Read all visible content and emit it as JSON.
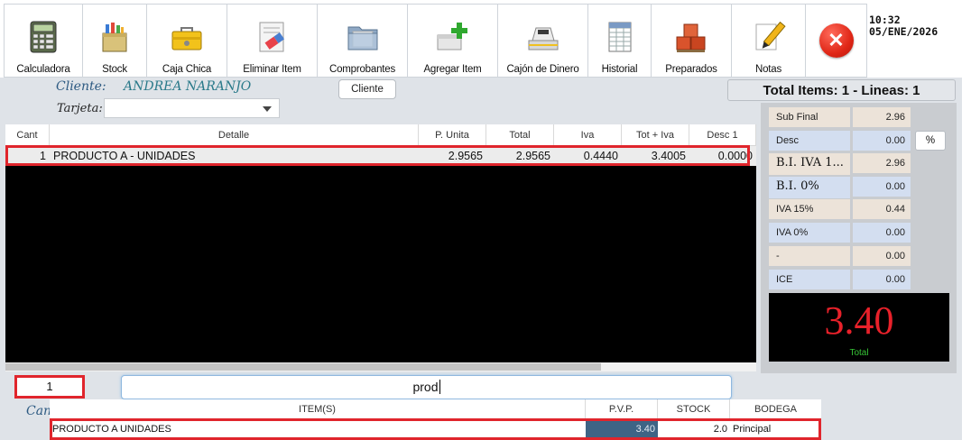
{
  "toolbar": {
    "buttons": [
      {
        "label": "Calculadora",
        "icon": "calculator-icon"
      },
      {
        "label": "Stock",
        "icon": "stock-box-icon"
      },
      {
        "label": "Caja Chica",
        "icon": "toolbox-icon"
      },
      {
        "label": "Eliminar Item",
        "icon": "eraser-icon"
      },
      {
        "label": "Comprobantes",
        "icon": "folder-icon"
      },
      {
        "label": "Agregar Item",
        "icon": "add-item-icon"
      },
      {
        "label": "Cajón de Dinero",
        "icon": "cash-register-icon"
      },
      {
        "label": "Historial",
        "icon": "spreadsheet-icon"
      },
      {
        "label": "Preparados",
        "icon": "crates-icon"
      },
      {
        "label": "Notas",
        "icon": "pencil-note-icon"
      }
    ],
    "close_icon": "close-icon"
  },
  "clock": {
    "time": "10:32",
    "date": "05/ENE/2026"
  },
  "customer": {
    "cliente_label": "Cliente:",
    "cliente_value": "ANDREA NARANJO",
    "tarjeta_label": "Tarjeta:",
    "tarjeta_value": "",
    "cliente_button": "Cliente"
  },
  "summary": {
    "total_items_text": "Total Items: 1 - Lineas: 1"
  },
  "grid": {
    "columns": [
      "Cant",
      "Detalle",
      "P. Unita",
      "Total",
      "Iva",
      "Tot + Iva",
      "Desc 1"
    ],
    "rows": [
      {
        "cant": "1",
        "detalle": "PRODUCTO A  - UNIDADES",
        "p_unita": "2.9565",
        "total": "2.9565",
        "iva": "0.4440",
        "tot_iva": "3.4005",
        "desc1": "0.0000"
      }
    ]
  },
  "totals": {
    "rows": [
      {
        "label": "Sub Final",
        "value": "2.96",
        "label_bg": "tan",
        "value_bg": "tan"
      },
      {
        "label": "Desc",
        "value": "0.00",
        "label_bg": "blue",
        "value_bg": "blue"
      },
      {
        "label": "B.I. IVA 1...",
        "value": "2.96",
        "label_bg": "tan",
        "value_bg": "tan"
      },
      {
        "label": "B.I. 0%",
        "value": "0.00",
        "label_bg": "blue",
        "value_bg": "blue"
      },
      {
        "label": "IVA 15%",
        "value": "0.44",
        "label_bg": "tan",
        "value_bg": "tan"
      },
      {
        "label": "IVA 0%",
        "value": "0.00",
        "label_bg": "blue",
        "value_bg": "blue"
      },
      {
        "label": "-",
        "value": "0.00",
        "label_bg": "tan",
        "value_bg": "tan"
      },
      {
        "label": "ICE",
        "value": "0.00",
        "label_bg": "blue",
        "value_bg": "blue"
      }
    ],
    "percent_button": "%",
    "grand_total": "3.40",
    "grand_total_label": "Total"
  },
  "entry": {
    "quantity": "1",
    "search_value": "prod",
    "cant_label": "Cant"
  },
  "results": {
    "columns": [
      "ITEM(S)",
      "P.V.P.",
      "STOCK",
      "BODEGA"
    ],
    "rows": [
      {
        "item": "PRODUCTO A UNIDADES",
        "pvp": "3.40",
        "stock": "2.0",
        "bodega": "Principal"
      }
    ]
  },
  "colors": {
    "highlight_red": "#e0252c",
    "total_red": "#e8212a",
    "selected_pvp_bg": "#3e6485"
  }
}
